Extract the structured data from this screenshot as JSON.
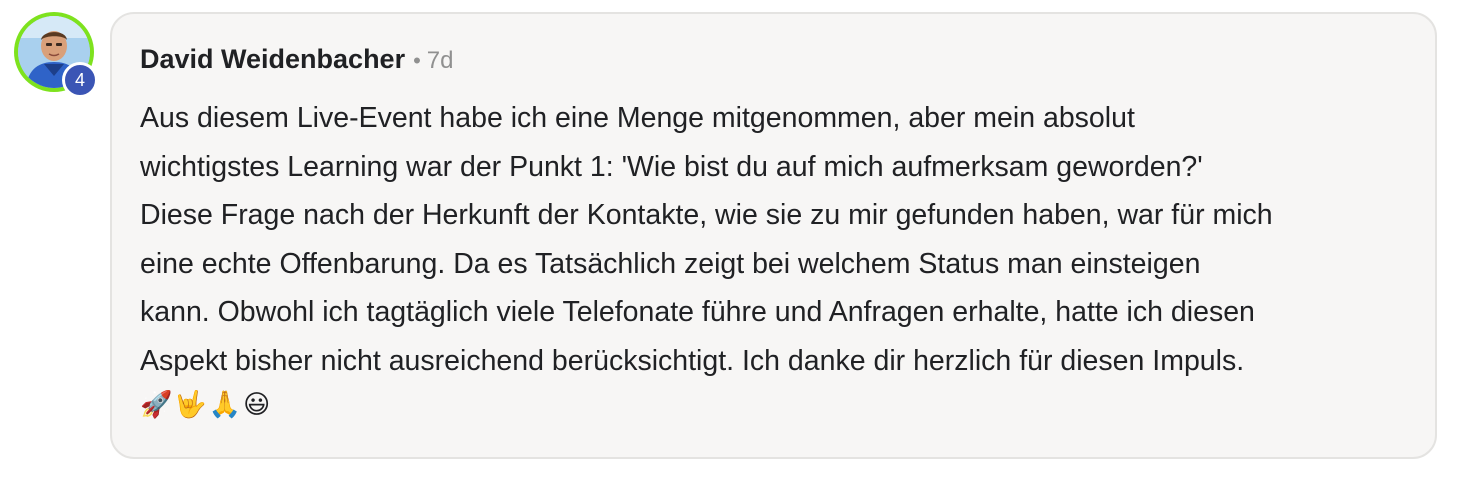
{
  "comment": {
    "author": "David Weidenbacher",
    "separator": "•",
    "time": "7d",
    "level": "4",
    "lines": [
      "Aus diesem Live-Event habe ich eine Menge mitgenommen, aber mein absolut",
      "wichtigstes Learning war der Punkt 1: 'Wie bist du auf mich aufmerksam geworden?'",
      "Diese Frage nach der Herkunft der Kontakte, wie sie zu mir gefunden haben, war für mich",
      "eine echte Offenbarung. Da es Tatsächlich zeigt bei welchem Status man einsteigen",
      "kann. Obwohl ich tagtäglich viele Telefonate führe und Anfragen erhalte, hatte ich diesen",
      "Aspekt bisher nicht ausreichend berücksichtigt. Ich danke dir herzlich für diesen Impuls."
    ],
    "emojis": [
      "🚀",
      "🤟",
      "🙏",
      "😃"
    ]
  },
  "colors": {
    "avatar_ring": "#7ee21e",
    "level_badge": "#3b55b5",
    "card_background": "#f7f6f5",
    "card_border": "#e4e3e1",
    "meta_text": "#909090"
  }
}
